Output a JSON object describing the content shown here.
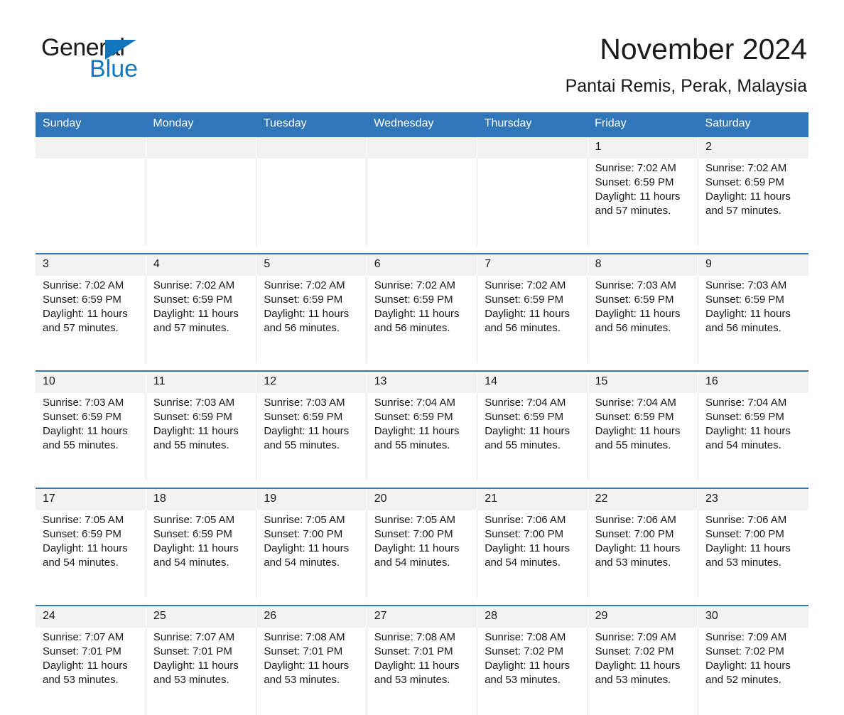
{
  "brand": {
    "word1": "General",
    "word2": "Blue",
    "triangle_color": "#1277bd"
  },
  "header": {
    "title": "November 2024",
    "subtitle": "Pantai Remis, Perak, Malaysia"
  },
  "theme": {
    "header_blue": "#3176b8",
    "daynum_bg": "#f2f2f2",
    "text": "#1a1a1a"
  },
  "weekday_headers": [
    "Sunday",
    "Monday",
    "Tuesday",
    "Wednesday",
    "Thursday",
    "Friday",
    "Saturday"
  ],
  "weeks": [
    [
      {
        "day": "",
        "lines": []
      },
      {
        "day": "",
        "lines": []
      },
      {
        "day": "",
        "lines": []
      },
      {
        "day": "",
        "lines": []
      },
      {
        "day": "",
        "lines": []
      },
      {
        "day": "1",
        "lines": [
          "Sunrise: 7:02 AM",
          "Sunset: 6:59 PM",
          "Daylight: 11 hours",
          "and 57 minutes."
        ]
      },
      {
        "day": "2",
        "lines": [
          "Sunrise: 7:02 AM",
          "Sunset: 6:59 PM",
          "Daylight: 11 hours",
          "and 57 minutes."
        ]
      }
    ],
    [
      {
        "day": "3",
        "lines": [
          "Sunrise: 7:02 AM",
          "Sunset: 6:59 PM",
          "Daylight: 11 hours",
          "and 57 minutes."
        ]
      },
      {
        "day": "4",
        "lines": [
          "Sunrise: 7:02 AM",
          "Sunset: 6:59 PM",
          "Daylight: 11 hours",
          "and 57 minutes."
        ]
      },
      {
        "day": "5",
        "lines": [
          "Sunrise: 7:02 AM",
          "Sunset: 6:59 PM",
          "Daylight: 11 hours",
          "and 56 minutes."
        ]
      },
      {
        "day": "6",
        "lines": [
          "Sunrise: 7:02 AM",
          "Sunset: 6:59 PM",
          "Daylight: 11 hours",
          "and 56 minutes."
        ]
      },
      {
        "day": "7",
        "lines": [
          "Sunrise: 7:02 AM",
          "Sunset: 6:59 PM",
          "Daylight: 11 hours",
          "and 56 minutes."
        ]
      },
      {
        "day": "8",
        "lines": [
          "Sunrise: 7:03 AM",
          "Sunset: 6:59 PM",
          "Daylight: 11 hours",
          "and 56 minutes."
        ]
      },
      {
        "day": "9",
        "lines": [
          "Sunrise: 7:03 AM",
          "Sunset: 6:59 PM",
          "Daylight: 11 hours",
          "and 56 minutes."
        ]
      }
    ],
    [
      {
        "day": "10",
        "lines": [
          "Sunrise: 7:03 AM",
          "Sunset: 6:59 PM",
          "Daylight: 11 hours",
          "and 55 minutes."
        ]
      },
      {
        "day": "11",
        "lines": [
          "Sunrise: 7:03 AM",
          "Sunset: 6:59 PM",
          "Daylight: 11 hours",
          "and 55 minutes."
        ]
      },
      {
        "day": "12",
        "lines": [
          "Sunrise: 7:03 AM",
          "Sunset: 6:59 PM",
          "Daylight: 11 hours",
          "and 55 minutes."
        ]
      },
      {
        "day": "13",
        "lines": [
          "Sunrise: 7:04 AM",
          "Sunset: 6:59 PM",
          "Daylight: 11 hours",
          "and 55 minutes."
        ]
      },
      {
        "day": "14",
        "lines": [
          "Sunrise: 7:04 AM",
          "Sunset: 6:59 PM",
          "Daylight: 11 hours",
          "and 55 minutes."
        ]
      },
      {
        "day": "15",
        "lines": [
          "Sunrise: 7:04 AM",
          "Sunset: 6:59 PM",
          "Daylight: 11 hours",
          "and 55 minutes."
        ]
      },
      {
        "day": "16",
        "lines": [
          "Sunrise: 7:04 AM",
          "Sunset: 6:59 PM",
          "Daylight: 11 hours",
          "and 54 minutes."
        ]
      }
    ],
    [
      {
        "day": "17",
        "lines": [
          "Sunrise: 7:05 AM",
          "Sunset: 6:59 PM",
          "Daylight: 11 hours",
          "and 54 minutes."
        ]
      },
      {
        "day": "18",
        "lines": [
          "Sunrise: 7:05 AM",
          "Sunset: 6:59 PM",
          "Daylight: 11 hours",
          "and 54 minutes."
        ]
      },
      {
        "day": "19",
        "lines": [
          "Sunrise: 7:05 AM",
          "Sunset: 7:00 PM",
          "Daylight: 11 hours",
          "and 54 minutes."
        ]
      },
      {
        "day": "20",
        "lines": [
          "Sunrise: 7:05 AM",
          "Sunset: 7:00 PM",
          "Daylight: 11 hours",
          "and 54 minutes."
        ]
      },
      {
        "day": "21",
        "lines": [
          "Sunrise: 7:06 AM",
          "Sunset: 7:00 PM",
          "Daylight: 11 hours",
          "and 54 minutes."
        ]
      },
      {
        "day": "22",
        "lines": [
          "Sunrise: 7:06 AM",
          "Sunset: 7:00 PM",
          "Daylight: 11 hours",
          "and 53 minutes."
        ]
      },
      {
        "day": "23",
        "lines": [
          "Sunrise: 7:06 AM",
          "Sunset: 7:00 PM",
          "Daylight: 11 hours",
          "and 53 minutes."
        ]
      }
    ],
    [
      {
        "day": "24",
        "lines": [
          "Sunrise: 7:07 AM",
          "Sunset: 7:01 PM",
          "Daylight: 11 hours",
          "and 53 minutes."
        ]
      },
      {
        "day": "25",
        "lines": [
          "Sunrise: 7:07 AM",
          "Sunset: 7:01 PM",
          "Daylight: 11 hours",
          "and 53 minutes."
        ]
      },
      {
        "day": "26",
        "lines": [
          "Sunrise: 7:08 AM",
          "Sunset: 7:01 PM",
          "Daylight: 11 hours",
          "and 53 minutes."
        ]
      },
      {
        "day": "27",
        "lines": [
          "Sunrise: 7:08 AM",
          "Sunset: 7:01 PM",
          "Daylight: 11 hours",
          "and 53 minutes."
        ]
      },
      {
        "day": "28",
        "lines": [
          "Sunrise: 7:08 AM",
          "Sunset: 7:02 PM",
          "Daylight: 11 hours",
          "and 53 minutes."
        ]
      },
      {
        "day": "29",
        "lines": [
          "Sunrise: 7:09 AM",
          "Sunset: 7:02 PM",
          "Daylight: 11 hours",
          "and 53 minutes."
        ]
      },
      {
        "day": "30",
        "lines": [
          "Sunrise: 7:09 AM",
          "Sunset: 7:02 PM",
          "Daylight: 11 hours",
          "and 52 minutes."
        ]
      }
    ]
  ]
}
